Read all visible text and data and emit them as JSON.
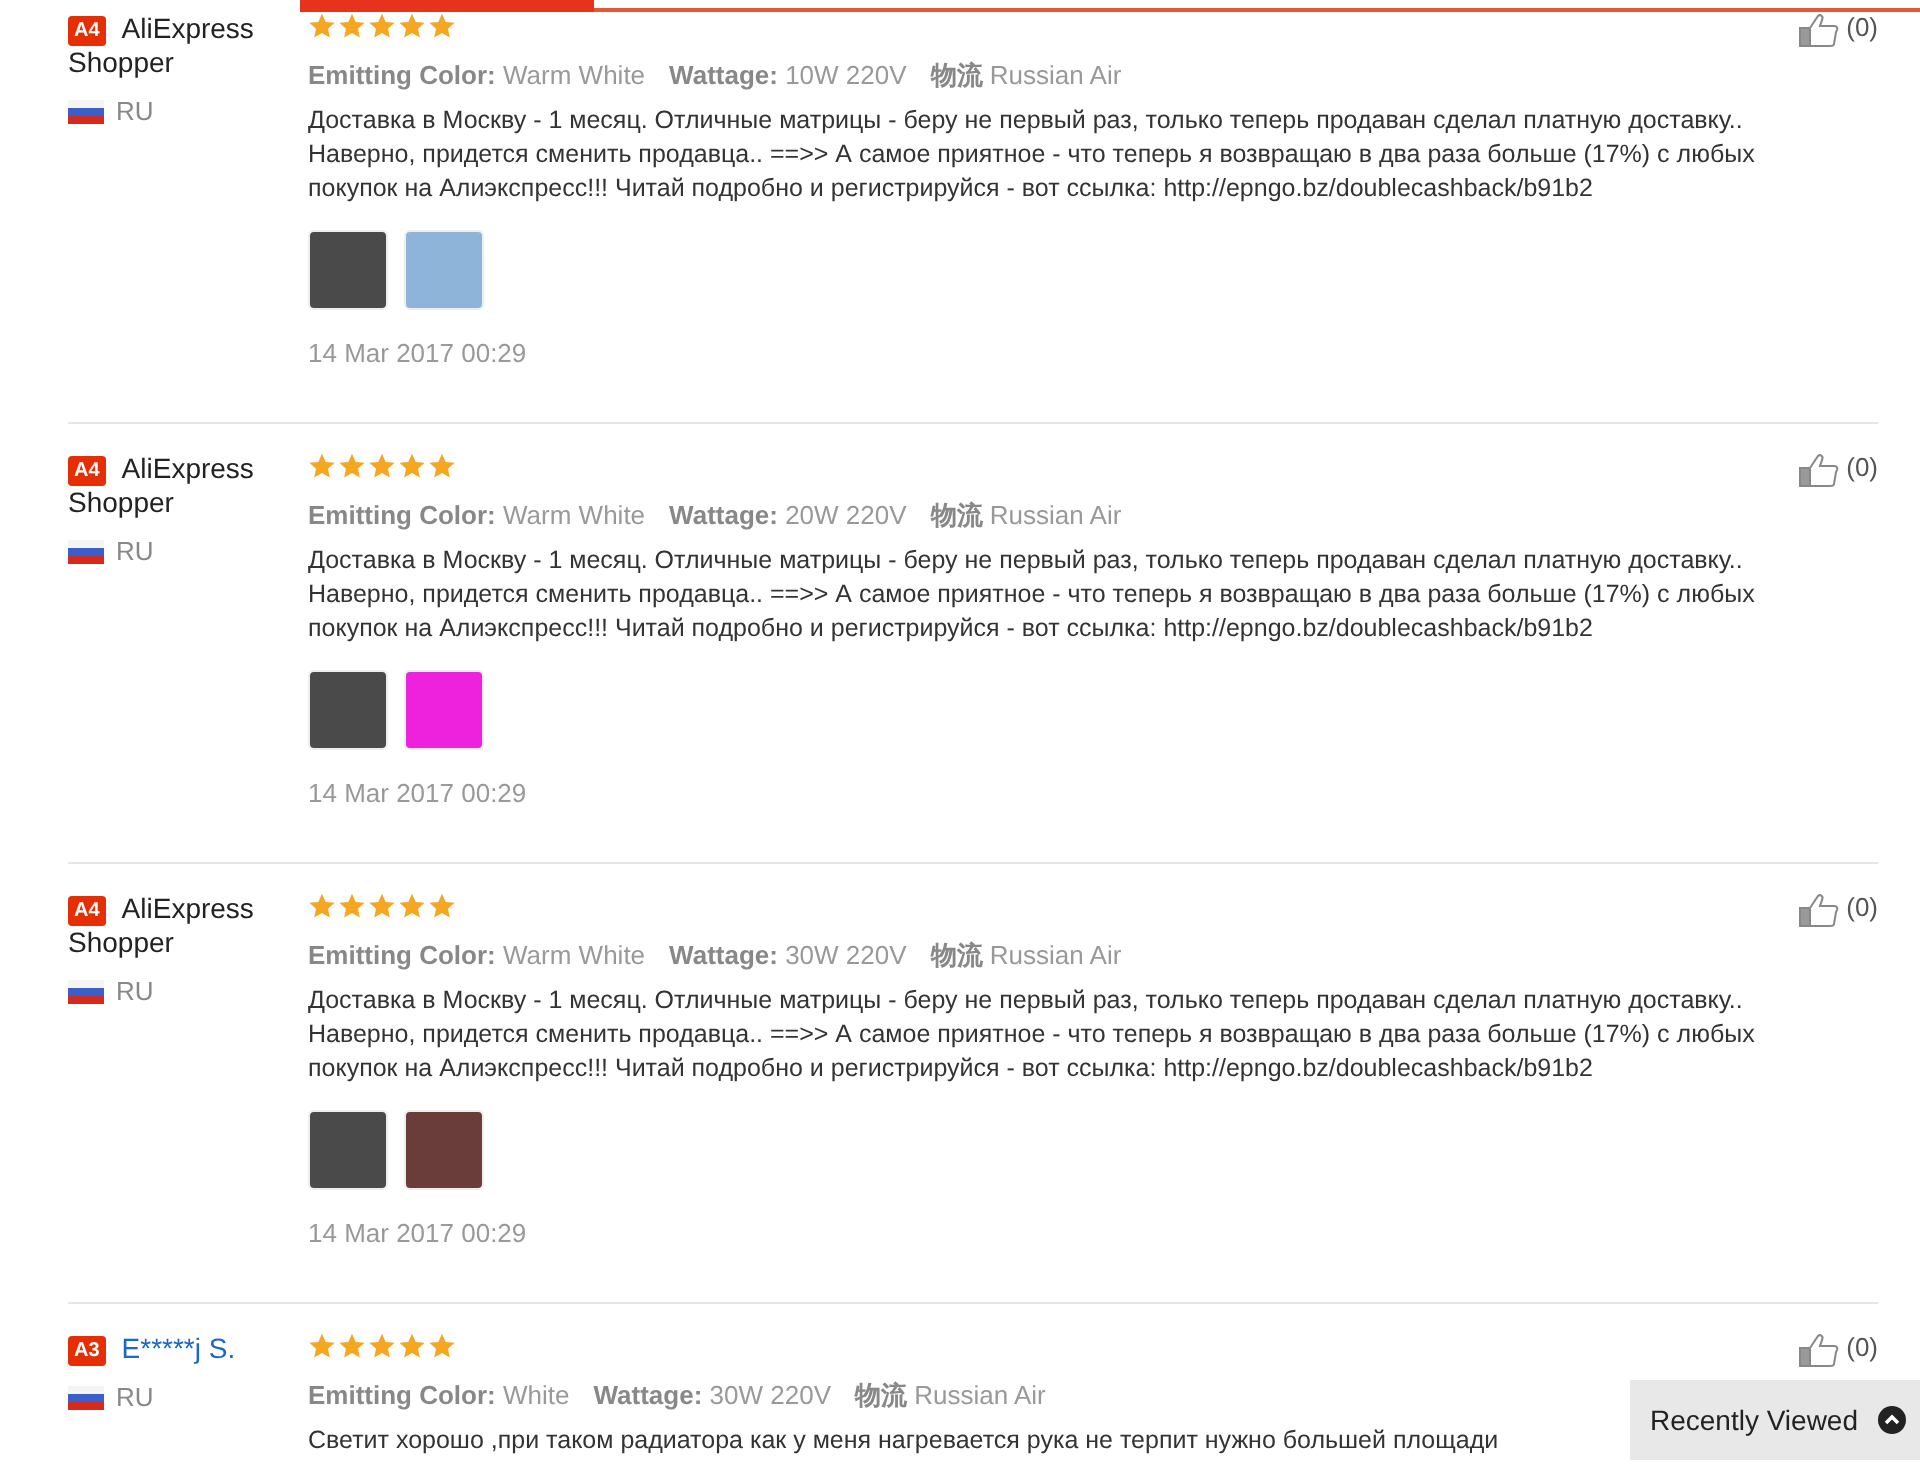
{
  "tabs_indicator": {
    "selected": true
  },
  "reviews": [
    {
      "badge": "A4",
      "name": "AliExpress Shopper",
      "name_is_link": false,
      "country": "RU",
      "stars": 5,
      "specs": [
        {
          "label": "Emitting Color:",
          "value": "Warm White"
        },
        {
          "label": "Wattage:",
          "value": "10W 220V"
        },
        {
          "label": "物流",
          "value": "Russian Air"
        }
      ],
      "text": "Доставка в Москву - 1 месяц. Отличные матрицы - беру не первый раз, только теперь продаван сделал платную доставку.. Наверно, придется сменить продавца.. ==>> А самое приятное - что теперь я возвращаю в два раза больше (17%) с любых покупок на Алиэкспресс!!! Читай подробно и регистрируйся - вот ссылка: http://epngo.bz/doublecashback/b91b2",
      "photos": [
        {
          "color": "#4a4a4a"
        },
        {
          "color": "#8fb4d9"
        }
      ],
      "date": "14 Mar 2017 00:29",
      "likes": "(0)"
    },
    {
      "badge": "A4",
      "name": "AliExpress Shopper",
      "name_is_link": false,
      "country": "RU",
      "stars": 5,
      "specs": [
        {
          "label": "Emitting Color:",
          "value": "Warm White"
        },
        {
          "label": "Wattage:",
          "value": "20W 220V"
        },
        {
          "label": "物流",
          "value": "Russian Air"
        }
      ],
      "text": "Доставка в Москву - 1 месяц. Отличные матрицы - беру не первый раз, только теперь продаван сделал платную доставку.. Наверно, придется сменить продавца.. ==>> А самое приятное - что теперь я возвращаю в два раза больше (17%) с любых покупок на Алиэкспресс!!! Читай подробно и регистрируйся - вот ссылка: http://epngo.bz/doublecashback/b91b2",
      "photos": [
        {
          "color": "#4a4a4a"
        },
        {
          "color": "#ee22dd"
        }
      ],
      "date": "14 Mar 2017 00:29",
      "likes": "(0)"
    },
    {
      "badge": "A4",
      "name": "AliExpress Shopper",
      "name_is_link": false,
      "country": "RU",
      "stars": 5,
      "specs": [
        {
          "label": "Emitting Color:",
          "value": "Warm White"
        },
        {
          "label": "Wattage:",
          "value": "30W 220V"
        },
        {
          "label": "物流",
          "value": "Russian Air"
        }
      ],
      "text": "Доставка в Москву - 1 месяц. Отличные матрицы - беру не первый раз, только теперь продаван сделал платную доставку.. Наверно, придется сменить продавца.. ==>> А самое приятное - что теперь я возвращаю в два раза больше (17%) с любых покупок на Алиэкспресс!!! Читай подробно и регистрируйся - вот ссылка: http://epngo.bz/doublecashback/b91b2",
      "photos": [
        {
          "color": "#4a4a4a"
        },
        {
          "color": "#6a3d3a"
        }
      ],
      "date": "14 Mar 2017 00:29",
      "likes": "(0)"
    },
    {
      "badge": "A3",
      "name": "E*****j S.",
      "name_is_link": true,
      "country": "RU",
      "stars": 5,
      "specs": [
        {
          "label": "Emitting Color:",
          "value": "White"
        },
        {
          "label": "Wattage:",
          "value": "30W 220V"
        },
        {
          "label": "物流",
          "value": "Russian Air"
        }
      ],
      "text": "Светит хорошо ,при таком радиатора как у меня нагревается рука не терпит нужно большей площади",
      "likes": "(0)"
    }
  ],
  "recently_viewed": {
    "label": "Recently Viewed",
    "expanded": false
  }
}
